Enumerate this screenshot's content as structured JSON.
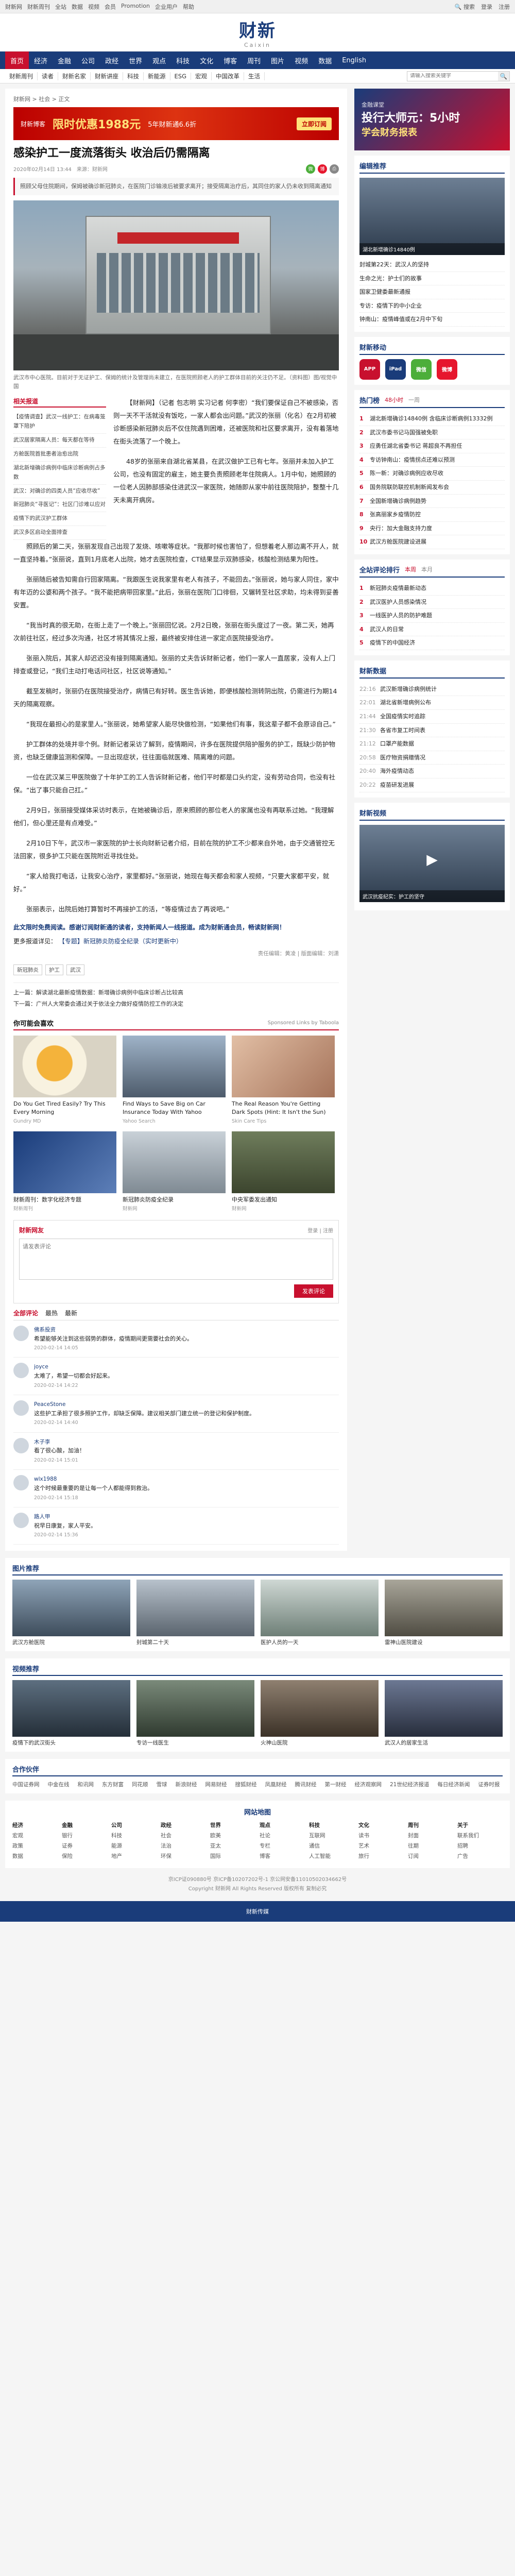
{
  "topbar": {
    "links": [
      "财新网",
      "财新周刊",
      "全站",
      "数据",
      "视频",
      "会员",
      "Promotion",
      "企业用户",
      "帮助"
    ],
    "login": "登录",
    "register": "注册",
    "search": "搜索"
  },
  "logo": {
    "cn": "财新",
    "en": "Caixin"
  },
  "nav": [
    "首页",
    "经济",
    "金融",
    "公司",
    "政经",
    "世界",
    "观点",
    "科技",
    "文化",
    "博客",
    "周刊",
    "图片",
    "视频",
    "数据",
    "English"
  ],
  "subnav": [
    "财新周刊",
    "读者",
    "财新名家",
    "财新讲座",
    "科技",
    "新能源",
    "ESG",
    "宏观",
    "中国改革",
    "生活"
  ],
  "subnav_search_placeholder": "请输入搜索关键字",
  "breadcrumb": "财新网 > 社会 > 正文",
  "ad_banner": {
    "left": "财新博客",
    "big": "限时优惠1988元",
    "mid": "5年财新通6.6折",
    "cta": "立即订阅"
  },
  "article": {
    "title": "感染护工一度流落街头 收治后仍需隔离",
    "date": "2020年02月14日 13:44",
    "source": "来源：财新网",
    "summary": "照顾父母住院期间，保姆被确诊新冠肺炎，在医院门诊输液后被要求离开；接受隔离治疗后，其同住的家人仍未收到隔离通知",
    "image_caption": "武汉市中心医院。目前对于无证护工、保姆的统计及管理尚未建立，在医院照顾老人的护工群体目前的关注仍不足。（资料图）图/视觉中国",
    "lede": "【财新网】（记者 包志明 实习记者 何李密）“我们要保证自己不被感染，否则一天不干活就没有饭吃，一家人都会出问题。”武汉的张丽（化名）在2月初被诊断感染新冠肺炎后不仅住院遇到困难，还被医院和社区要求离开，没有着落地在街头流落了一个晚上。",
    "paragraphs": [
      "48岁的张丽来自湖北省某县，在武汉做护工已有七年。张丽并未加入护工公司，也没有固定的雇主，她主要负责照顾老年住院病人。1月中旬，她照顾的一位老人因肺部感染住进武汉一家医院，她随即从家中前往医院陪护，整整十几天未离开病房。",
      "照顾后的第二天，张丽发现自己出现了发烧、咳嗽等症状。“我那时候也害怕了，但想着老人那边离不开人，就一直坚持着。”张丽说，直到1月底老人出院，她才去医院检查，CT结果显示双肺感染，核酸检测结果为阳性。",
      "张丽随后被告知需自行回家隔离。“我跟医生说我家里有老人有孩子，不能回去。”张丽说，她与家人同住，家中有年迈的公婆和两个孩子。“我不能把病带回家里。”此后，张丽在医院门口徘徊，又辗转至社区求助，均未得到妥善安置。",
      "“我当时真的很无助，在街上走了一个晚上。”张丽回忆说。2月2日晚，张丽在街头度过了一夜。第二天，她再次前往社区，经过多次沟通，社区才将其情况上报，最终被安排住进一家定点医院接受治疗。",
      "张丽入院后，其家人却迟迟没有接到隔离通知。张丽的丈夫告诉财新记者，他们一家人一直居家，没有人上门排查或登记，“我们主动打电话问社区，社区说等通知。”",
      "截至发稿时，张丽仍在医院接受治疗，病情已有好转。医生告诉她，即便核酸检测转阴出院，仍需进行为期14天的隔离观察。",
      "“我现在最担心的是家里人。”张丽说，她希望家人能尽快做检测，“如果他们有事，我这辈子都不会原谅自己。”",
      "护工群体的处境并非个例。财新记者采访了解到，疫情期间，许多在医院提供陪护服务的护工，既缺少防护物资，也缺乏健康监测和保障。一旦出现症状，往往面临就医难、隔离难的问题。",
      "一位在武汉某三甲医院做了十年护工的工人告诉财新记者，他们平时都是口头约定，没有劳动合同，也没有社保。“出了事只能自己扛。”",
      "2月9日，张丽接受媒体采访时表示，在她被确诊后，原来照顾的那位老人的家属也没有再联系过她。“我理解他们，但心里还是有点难受。”",
      "2月10日下午，武汉市一家医院的护士长向财新记者介绍，目前在院的护工不少都来自外地，由于交通管控无法回家，很多护工只能在医院附近寻找住处。",
      "“家人给我打电话，让我安心治疗，家里都好。”张丽说，她现在每天都会和家人视频，“只要大家都平安，就好。”",
      "张丽表示，出院后她打算暂时不再接护工的活，“等疫情过去了再说吧。”"
    ],
    "notice": "此文限时免费阅读。感谢订阅财新通的读者，支持新闻人一线报道。成为财新通会员，畅读财新网！",
    "more_label": "更多报道详见：",
    "more_link": "【专题】新冠肺炎防疫全纪录（实时更新中）",
    "editor": "责任编辑：黄凌 | 版面编辑：刘潇",
    "tags": [
      "新冠肺炎",
      "护工",
      "武汉"
    ],
    "prev": "上一篇：解读湖北最新疫情数据：新增确诊病例中临床诊断占比较高",
    "next": "下一篇：广州人大常委会通过关于依法全力做好疫情防控工作的决定"
  },
  "related": {
    "heading": "相关报道",
    "items": [
      "【疫情调查】武汉一线护工：在病毒笼罩下陪护",
      "武汉居家隔离人员：每天都在等待",
      "方舱医院首批患者治愈出院",
      "湖北新增确诊病例中临床诊断病例占多数",
      "武汉：对确诊的四类人员“应收尽收”",
      "新冠肺炎“寻医记”：社区门诊难以应对",
      "疫情下的武汉护工群体",
      "武汉多区启动全面排查"
    ]
  },
  "you_may_like": {
    "heading": "你可能会喜欢",
    "aside": "Sponsored Links by Taboola",
    "cards": [
      {
        "title": "Do You Get Tired Easily? Try This Every Morning",
        "sponsor": "Gundry MD"
      },
      {
        "title": "Find Ways to Save Big on Car Insurance Today With Yahoo",
        "sponsor": "Yahoo Search"
      },
      {
        "title": "The Real Reason You're Getting Dark Spots (Hint: It Isn't the Sun)",
        "sponsor": "Skin Care Tips"
      },
      {
        "title": "财新周刊：数字化经济专题",
        "sponsor": "财新周刊"
      },
      {
        "title": "新冠肺炎防疫全纪录",
        "sponsor": "财新网"
      },
      {
        "title": "中央军委发出通知",
        "sponsor": "财新网"
      }
    ]
  },
  "comments": {
    "heading": "财新网友",
    "login_hint": "登录 | 注册",
    "placeholder": "请发表评论",
    "submit": "发表评论",
    "tab_all": "全部评论",
    "tab_hot": "最热",
    "tab_new": "最新",
    "items": [
      {
        "name": "佛系投资",
        "text": "希望能够关注到这些弱势的群体，疫情期间更需要社会的关心。",
        "time": "2020-02-14 14:05"
      },
      {
        "name": "joyce",
        "text": "太难了，希望一切都会好起来。",
        "time": "2020-02-14 14:22"
      },
      {
        "name": "PeaceStone",
        "text": "这些护工承担了很多照护工作，却缺乏保障。建议相关部门建立统一的登记和保护制度。",
        "time": "2020-02-14 14:40"
      },
      {
        "name": "木子李",
        "text": "看了很心酸，加油！",
        "time": "2020-02-14 15:01"
      },
      {
        "name": "wlx1988",
        "text": "这个时候最重要的是让每一个人都能得到救治。",
        "time": "2020-02-14 15:18"
      },
      {
        "name": "路人甲",
        "text": "祝早日康复，家人平安。",
        "time": "2020-02-14 15:36"
      }
    ]
  },
  "sidebar": {
    "ad": {
      "a": "金融课堂",
      "b": "投行大师元：5小时",
      "c": "学会财务报表"
    },
    "picks_heading": "编辑推荐",
    "picks": [
      "湖北新增确诊14840例",
      "封城第22天：武汉人的坚持",
      "生命之光：护士们的故事",
      "国家卫健委最新通报",
      "专访：疫情下的中小企业",
      "钟南山：疫情峰值或在2月中下旬"
    ],
    "hot_heading": "热门榜",
    "hot_tabs": [
      "48小时",
      "一周"
    ],
    "hot": [
      "湖北新增确诊14840例 含临床诊断病例13332例",
      "武汉市委书记马国强被免职",
      "应勇任湖北省委书记 蒋超良不再担任",
      "专访钟南山：疫情拐点还难以预测",
      "陈一新：对确诊病例应收尽收",
      "国务院联防联控机制新闻发布会",
      "全国新增确诊病例趋势",
      "张高丽家乡疫情防控",
      "央行：加大金融支持力度",
      "武汉方舱医院建设进展"
    ],
    "live_heading": "全站评论排行",
    "live_tabs": [
      "本周",
      "本月"
    ],
    "live": [
      "新冠肺炎疫情最新动态",
      "武汉医护人员感染情况",
      "一线医护人员的防护难题",
      "武汉人的日常",
      "疫情下的中国经济"
    ],
    "apps_heading": "财新移动",
    "apps": [
      "APP",
      "iPad",
      "微信",
      "微博"
    ],
    "news_heading": "财新数据",
    "news": [
      {
        "time": "22:16",
        "text": "武汉新增确诊病例统计"
      },
      {
        "time": "22:01",
        "text": "湖北省新增病例公布"
      },
      {
        "time": "21:44",
        "text": "全国疫情实时追踪"
      },
      {
        "time": "21:30",
        "text": "各省市复工时间表"
      },
      {
        "time": "21:12",
        "text": "口罩产能数据"
      },
      {
        "time": "20:58",
        "text": "医疗物资捐赠情况"
      },
      {
        "time": "20:40",
        "text": "海外疫情动态"
      },
      {
        "time": "20:22",
        "text": "疫苗研发进展"
      }
    ],
    "video_heading": "财新视频",
    "video_caption": "武汉抗疫纪实：护工的坚守"
  },
  "photos": {
    "heading": "图片推荐",
    "items": [
      "武汉方舱医院",
      "封城第二十天",
      "医护人员的一天",
      "雷神山医院建设"
    ]
  },
  "videos": {
    "heading": "视频推荐",
    "items": [
      "疫情下的武汉街头",
      "专访一线医生",
      "火神山医院",
      "武汉人的居家生活"
    ]
  },
  "links": {
    "heading": "合作伙伴",
    "items": [
      "中国证券网",
      "中金在线",
      "和讯网",
      "东方财富",
      "同花顺",
      "雪球",
      "新浪财经",
      "网易财经",
      "搜狐财经",
      "凤凰财经",
      "腾讯财经",
      "第一财经",
      "经济观察网",
      "21世纪经济报道",
      "每日经济新闻",
      "证券时报"
    ]
  },
  "sitemap": {
    "heading": "网站地图",
    "cols": [
      {
        "h": "经济",
        "items": [
          "宏观",
          "政策",
          "数据"
        ]
      },
      {
        "h": "金融",
        "items": [
          "银行",
          "证券",
          "保险"
        ]
      },
      {
        "h": "公司",
        "items": [
          "科技",
          "能源",
          "地产"
        ]
      },
      {
        "h": "政经",
        "items": [
          "社会",
          "法治",
          "环保"
        ]
      },
      {
        "h": "世界",
        "items": [
          "欧美",
          "亚太",
          "国际"
        ]
      },
      {
        "h": "观点",
        "items": [
          "社论",
          "专栏",
          "博客"
        ]
      },
      {
        "h": "科技",
        "items": [
          "互联网",
          "通信",
          "人工智能"
        ]
      },
      {
        "h": "文化",
        "items": [
          "读书",
          "艺术",
          "旅行"
        ]
      },
      {
        "h": "周刊",
        "items": [
          "封面",
          "往期",
          "订阅"
        ]
      },
      {
        "h": "关于",
        "items": [
          "联系我们",
          "招聘",
          "广告"
        ]
      }
    ]
  },
  "copyright": {
    "line1": "京ICP证090880号 京ICP备10207202号-1 京公网安备11010502034662号",
    "line2": "Copyright 财新网 All Rights Reserved 版权所有 复制必究"
  },
  "bottom": "财新传媒"
}
